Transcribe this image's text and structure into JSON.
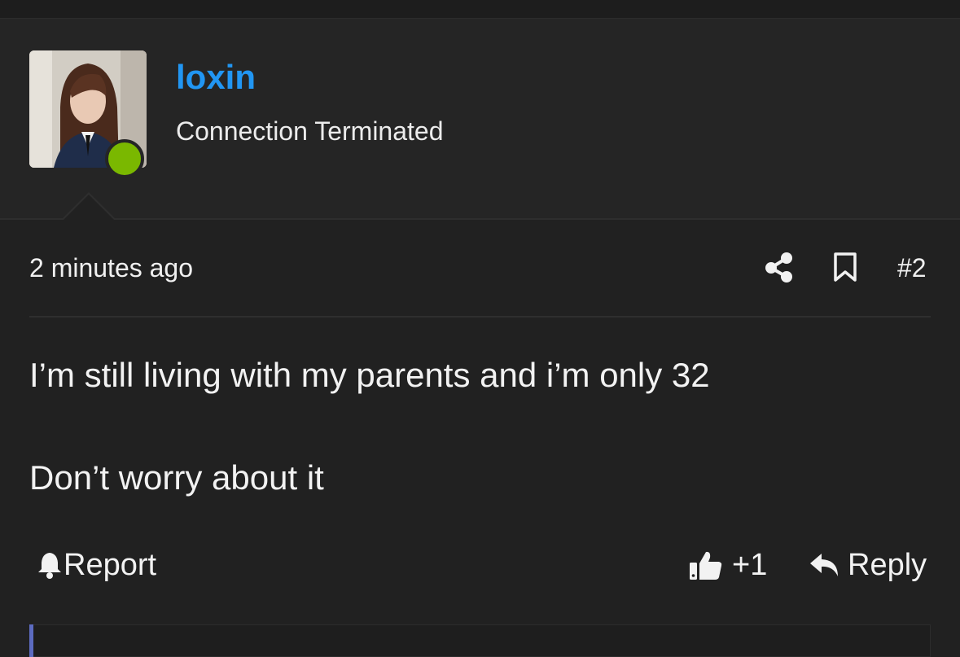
{
  "user": {
    "name": "loxin",
    "title": "Connection Terminated",
    "online": true,
    "name_color": "#2196f3",
    "online_color": "#7ab800"
  },
  "post": {
    "time": "2 minutes ago",
    "number": "#2",
    "content": [
      "I’m still living with my parents and i’m only 32",
      "Don’t worry about it"
    ]
  },
  "actions": {
    "report_label": "Report",
    "like_label": "+1",
    "reply_label": "Reply"
  },
  "icons": [
    "share-icon",
    "bookmark-icon",
    "bell-icon",
    "thumbs-up-icon",
    "reply-icon"
  ]
}
